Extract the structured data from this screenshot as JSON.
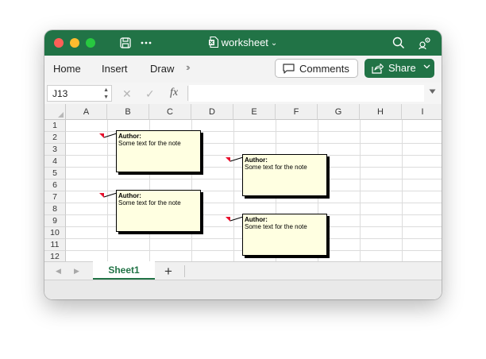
{
  "window": {
    "title": "worksheet",
    "accent_color": "#217346"
  },
  "ribbon": {
    "tabs": [
      "Home",
      "Insert",
      "Draw"
    ],
    "comments_label": "Comments",
    "share_label": "Share"
  },
  "formula_bar": {
    "name_box": "J13",
    "fx_label": "fx",
    "formula": ""
  },
  "grid": {
    "columns": [
      "A",
      "B",
      "C",
      "D",
      "E",
      "F",
      "G",
      "H",
      "I"
    ],
    "rows": [
      "1",
      "2",
      "3",
      "4",
      "5",
      "6",
      "7",
      "8",
      "9",
      "10",
      "11",
      "12"
    ]
  },
  "notes": [
    {
      "cell": "B2",
      "author": "Author:",
      "text": "Some text for the note"
    },
    {
      "cell": "E4",
      "author": "Author:",
      "text": "Some text for the note"
    },
    {
      "cell": "B7",
      "author": "Author:",
      "text": "Some text for the note"
    },
    {
      "cell": "E9",
      "author": "Author:",
      "text": "Some text for the note"
    }
  ],
  "sheets": {
    "tabs": [
      "Sheet1"
    ],
    "active": "Sheet1"
  }
}
